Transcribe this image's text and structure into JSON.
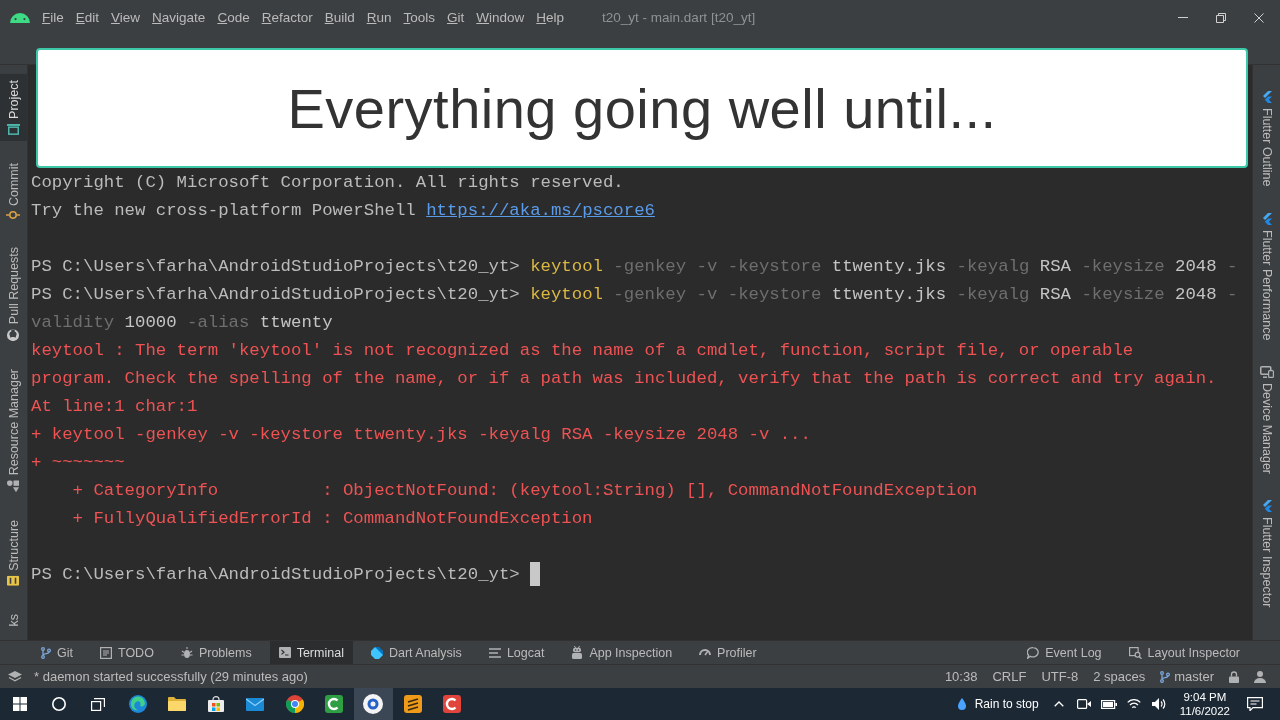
{
  "window": {
    "title": "t20_yt - main.dart [t20_yt]",
    "menu": [
      "File",
      "Edit",
      "View",
      "Navigate",
      "Code",
      "Refactor",
      "Build",
      "Run",
      "Tools",
      "Git",
      "Window",
      "Help"
    ]
  },
  "caption": "Everything going well until...",
  "left_tool_tabs": [
    {
      "label": "Project",
      "selected": true
    },
    {
      "label": "Commit",
      "selected": false
    },
    {
      "label": "Pull Requests",
      "selected": false
    },
    {
      "label": "Resource Manager",
      "selected": false
    },
    {
      "label": "Structure",
      "selected": false
    },
    {
      "label": "ks",
      "selected": false
    }
  ],
  "right_tool_tabs": [
    {
      "label": "Flutter Outline",
      "selected": false
    },
    {
      "label": "Flutter Performance",
      "selected": false
    },
    {
      "label": "Device Manager",
      "selected": false
    },
    {
      "label": "Flutter Inspector",
      "selected": false
    }
  ],
  "terminal": {
    "blocks": [
      {
        "lines": [
          {
            "kind": "output",
            "text": "Copyright (C) Microsoft Corporation. All rights reserved."
          },
          {
            "kind": "output",
            "text": "Try the new cross-platform PowerShell",
            "link": "https://aka.ms/pscore6"
          }
        ]
      },
      {
        "lines": [
          {
            "kind": "command",
            "prompt": "PS C:\\Users\\farha\\AndroidStudioProjects\\t20_yt>",
            "tokens": [
              {
                "kind": "command",
                "text": "keytool"
              },
              {
                "kind": "parameter",
                "text": "-genkey"
              },
              {
                "kind": "parameter",
                "text": "-v"
              },
              {
                "kind": "parameter",
                "text": "-keystore"
              },
              {
                "kind": "argument",
                "text": "ttwenty.jks"
              },
              {
                "kind": "parameter",
                "text": "-keyalg"
              },
              {
                "kind": "argument",
                "text": "RSA"
              },
              {
                "kind": "parameter",
                "text": "-keysize"
              },
              {
                "kind": "argument",
                "text": "2048"
              },
              {
                "kind": "parameter",
                "text": "-"
              }
            ]
          },
          {
            "kind": "command",
            "prompt": "PS C:\\Users\\farha\\AndroidStudioProjects\\t20_yt>",
            "tokens": [
              {
                "kind": "command",
                "text": "keytool"
              },
              {
                "kind": "parameter",
                "text": "-genkey"
              },
              {
                "kind": "parameter",
                "text": "-v"
              },
              {
                "kind": "parameter",
                "text": "-keystore"
              },
              {
                "kind": "argument",
                "text": "ttwenty.jks"
              },
              {
                "kind": "parameter",
                "text": "-keyalg"
              },
              {
                "kind": "argument",
                "text": "RSA"
              },
              {
                "kind": "parameter",
                "text": "-keysize"
              },
              {
                "kind": "argument",
                "text": "2048"
              },
              {
                "kind": "parameter",
                "text": "-"
              }
            ]
          },
          {
            "kind": "continuation",
            "tokens": [
              {
                "kind": "parameter",
                "text": "validity"
              },
              {
                "kind": "argument",
                "text": "10000"
              },
              {
                "kind": "parameter",
                "text": "-alias"
              },
              {
                "kind": "argument",
                "text": "ttwenty"
              }
            ]
          },
          {
            "kind": "error",
            "text": "keytool : The term 'keytool' is not recognized as the name of a cmdlet, function, script file, or operable"
          },
          {
            "kind": "error",
            "text": "program. Check the spelling of the name, or if a path was included, verify that the path is correct and try again."
          },
          {
            "kind": "error",
            "text": "At line:1 char:1"
          },
          {
            "kind": "error",
            "text": "+ keytool -genkey -v -keystore ttwenty.jks -keyalg RSA -keysize 2048 -v ..."
          },
          {
            "kind": "error",
            "text": "+ ~~~~~~~"
          },
          {
            "kind": "error_detail",
            "text": "+ CategoryInfo          : ObjectNotFound: (keytool:String) [], CommandNotFoundException"
          },
          {
            "kind": "error_detail",
            "text": "+ FullyQualifiedErrorId : CommandNotFoundException"
          }
        ]
      },
      {
        "lines": [
          {
            "kind": "command",
            "prompt": "PS C:\\Users\\farha\\AndroidStudioProjects\\t20_yt>",
            "cursor": true
          }
        ]
      }
    ]
  },
  "tool_window_bar": {
    "left": [
      {
        "label": "Git",
        "selected": false
      },
      {
        "label": "TODO",
        "selected": false
      },
      {
        "label": "Problems",
        "selected": false
      },
      {
        "label": "Terminal",
        "selected": true
      },
      {
        "label": "Dart Analysis",
        "selected": false
      },
      {
        "label": "Logcat",
        "selected": false
      },
      {
        "label": "App Inspection",
        "selected": false
      },
      {
        "label": "Profiler",
        "selected": false
      }
    ],
    "right": [
      {
        "label": "Event Log",
        "selected": false
      },
      {
        "label": "Layout Inspector",
        "selected": false
      }
    ]
  },
  "status_bar": {
    "message": "* daemon started successfully (29 minutes ago)",
    "items": [
      "10:38",
      "CRLF",
      "UTF-8",
      "2 spaces"
    ],
    "branch": "master"
  },
  "taskbar": {
    "apps": [
      {
        "selected": false
      },
      {
        "selected": false
      },
      {
        "selected": false
      },
      {
        "selected": false
      },
      {
        "selected": false
      },
      {
        "selected": false
      },
      {
        "selected": true
      },
      {
        "selected": false
      },
      {
        "selected": false
      }
    ],
    "weather": "Rain to stop",
    "time": "9:04 PM",
    "date": "11/6/2022"
  }
}
